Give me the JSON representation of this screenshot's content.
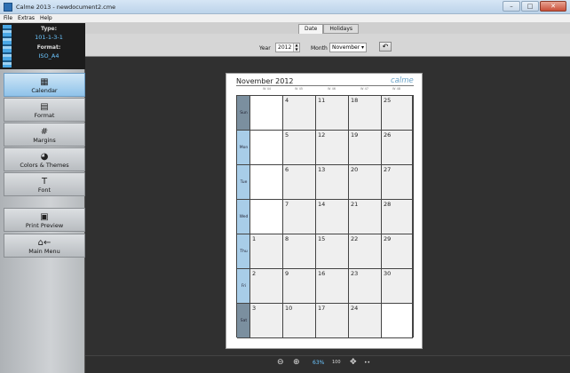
{
  "window": {
    "title": "Calme 2013 - newdocument2.cme",
    "minimize": "–",
    "maximize": "□",
    "close": "✕"
  },
  "menu": [
    "File",
    "Extras",
    "Help"
  ],
  "docinfo": {
    "type_label": "Type:",
    "type_value": "101-1-3-1",
    "format_label": "Format:",
    "format_value": "ISO_A4"
  },
  "nav": [
    {
      "label": "Calendar",
      "icon": "calendar-icon",
      "glyph": "▦"
    },
    {
      "label": "Format",
      "icon": "format-icon",
      "glyph": "▤"
    },
    {
      "label": "Margins",
      "icon": "margins-icon",
      "glyph": "#"
    },
    {
      "label": "Colors & Themes",
      "icon": "palette-icon",
      "glyph": "◕"
    },
    {
      "label": "Font",
      "icon": "font-icon",
      "glyph": "T"
    },
    {
      "label": "Print Preview",
      "icon": "printer-icon",
      "glyph": "▣"
    },
    {
      "label": "Main Menu",
      "icon": "home-back-icon",
      "glyph": "⌂←"
    }
  ],
  "tabs": [
    "Date",
    "Holidays"
  ],
  "toolbar": {
    "year_label": "Year",
    "year_value": "2012",
    "month_label": "Month",
    "month_value": "November",
    "undo_glyph": "↶"
  },
  "calendar": {
    "title": "November 2012",
    "brand": "calme",
    "weeks": [
      "W 44",
      "W 45",
      "W 46",
      "W 47",
      "W 48"
    ],
    "days": [
      "Sun",
      "Mon",
      "Tue",
      "Wed",
      "Thu",
      "Fri",
      "Sat"
    ],
    "cells": [
      [
        "",
        "4",
        "11",
        "18",
        "25"
      ],
      [
        "",
        "5",
        "12",
        "19",
        "26"
      ],
      [
        "",
        "6",
        "13",
        "20",
        "27"
      ],
      [
        "",
        "7",
        "14",
        "21",
        "28"
      ],
      [
        "1",
        "8",
        "15",
        "22",
        "29"
      ],
      [
        "2",
        "9",
        "16",
        "23",
        "30"
      ],
      [
        "3",
        "10",
        "17",
        "24",
        ""
      ]
    ]
  },
  "status": {
    "zoom": "63%",
    "zoom_out_glyph": "⊖",
    "zoom_in_glyph": "⊕",
    "fit_label": "100",
    "move_glyph": "✥",
    "more_glyph": "••"
  },
  "colors": {
    "accent": "#6cc6ff",
    "cell": "#efefef",
    "sun_header": "#7b8f9f",
    "day_header": "#a8cde8"
  }
}
